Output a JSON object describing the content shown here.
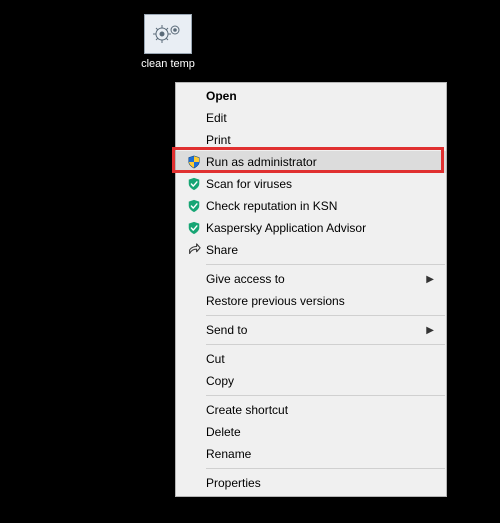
{
  "desktop_icon": {
    "label": "clean temp",
    "icon_name": "batch-file-gears-icon"
  },
  "context_menu": {
    "groups": [
      [
        {
          "id": "open",
          "label": "Open",
          "bold": true,
          "icon": null,
          "submenu": false
        },
        {
          "id": "edit",
          "label": "Edit",
          "bold": false,
          "icon": null,
          "submenu": false
        },
        {
          "id": "print",
          "label": "Print",
          "bold": false,
          "icon": null,
          "submenu": false
        },
        {
          "id": "run-admin",
          "label": "Run as administrator",
          "bold": false,
          "icon": "uac-shield-icon",
          "submenu": false,
          "highlight": true,
          "hover": true
        },
        {
          "id": "scan-viruses",
          "label": "Scan for viruses",
          "bold": false,
          "icon": "kaspersky-shield-icon",
          "submenu": false
        },
        {
          "id": "check-ksn",
          "label": "Check reputation in KSN",
          "bold": false,
          "icon": "kaspersky-shield-icon",
          "submenu": false
        },
        {
          "id": "kaspersky-advisor",
          "label": "Kaspersky Application Advisor",
          "bold": false,
          "icon": "kaspersky-shield-icon",
          "submenu": false
        },
        {
          "id": "share",
          "label": "Share",
          "bold": false,
          "icon": "share-icon",
          "submenu": false
        }
      ],
      [
        {
          "id": "give-access",
          "label": "Give access to",
          "bold": false,
          "icon": null,
          "submenu": true
        },
        {
          "id": "restore-prev",
          "label": "Restore previous versions",
          "bold": false,
          "icon": null,
          "submenu": false
        }
      ],
      [
        {
          "id": "send-to",
          "label": "Send to",
          "bold": false,
          "icon": null,
          "submenu": true
        }
      ],
      [
        {
          "id": "cut",
          "label": "Cut",
          "bold": false,
          "icon": null,
          "submenu": false
        },
        {
          "id": "copy",
          "label": "Copy",
          "bold": false,
          "icon": null,
          "submenu": false
        }
      ],
      [
        {
          "id": "create-shortcut",
          "label": "Create shortcut",
          "bold": false,
          "icon": null,
          "submenu": false
        },
        {
          "id": "delete",
          "label": "Delete",
          "bold": false,
          "icon": null,
          "submenu": false
        },
        {
          "id": "rename",
          "label": "Rename",
          "bold": false,
          "icon": null,
          "submenu": false
        }
      ],
      [
        {
          "id": "properties",
          "label": "Properties",
          "bold": false,
          "icon": null,
          "submenu": false
        }
      ]
    ]
  }
}
